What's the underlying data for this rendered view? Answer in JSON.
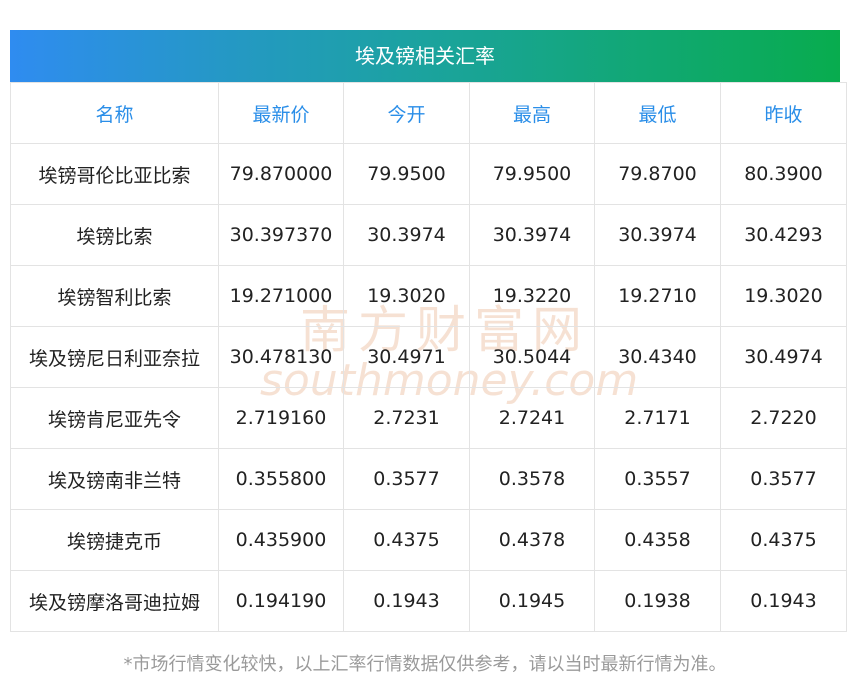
{
  "title": "埃及镑相关汇率",
  "headers": [
    "名称",
    "最新价",
    "今开",
    "最高",
    "最低",
    "昨收"
  ],
  "rows": [
    [
      "埃镑哥伦比亚比索",
      "79.870000",
      "79.9500",
      "79.9500",
      "79.8700",
      "80.3900"
    ],
    [
      "埃镑比索",
      "30.397370",
      "30.3974",
      "30.3974",
      "30.3974",
      "30.4293"
    ],
    [
      "埃镑智利比索",
      "19.271000",
      "19.3020",
      "19.3220",
      "19.2710",
      "19.3020"
    ],
    [
      "埃及镑尼日利亚奈拉",
      "30.478130",
      "30.4971",
      "30.5044",
      "30.4340",
      "30.4974"
    ],
    [
      "埃镑肯尼亚先令",
      "2.719160",
      "2.7231",
      "2.7241",
      "2.7171",
      "2.7220"
    ],
    [
      "埃及镑南非兰特",
      "0.355800",
      "0.3577",
      "0.3578",
      "0.3557",
      "0.3577"
    ],
    [
      "埃镑捷克币",
      "0.435900",
      "0.4375",
      "0.4378",
      "0.4358",
      "0.4375"
    ],
    [
      "埃及镑摩洛哥迪拉姆",
      "0.194190",
      "0.1943",
      "0.1945",
      "0.1938",
      "0.1943"
    ]
  ],
  "watermark": {
    "cn": "南方财富网",
    "en": "southmoney.com"
  },
  "note": "*市场行情变化较快，以上汇率行情数据仅供参考，请以当时最新行情为准。",
  "colors": {
    "header_text": "#2a8ee8",
    "gradient_start": "#2f8cf0",
    "gradient_end": "#08ac4e"
  }
}
